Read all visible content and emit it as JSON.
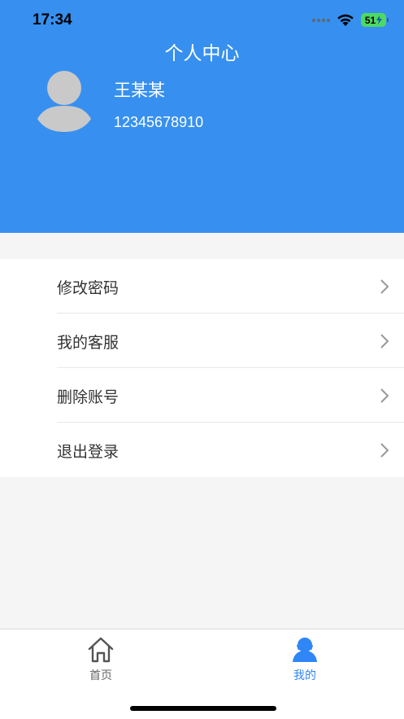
{
  "status_bar": {
    "time": "17:34",
    "battery": "51",
    "icons": [
      "signal-dots-icon",
      "wifi-icon",
      "battery-charging-icon"
    ]
  },
  "header": {
    "title": "个人中心",
    "user_name": "王某某",
    "phone": "12345678910",
    "avatar_icon": "avatar-placeholder-icon",
    "background_color": "#3790ef"
  },
  "menu": {
    "items": [
      {
        "label": "修改密码",
        "icon": "chevron-right-icon"
      },
      {
        "label": "我的客服",
        "icon": "chevron-right-icon"
      },
      {
        "label": "删除账号",
        "icon": "chevron-right-icon"
      },
      {
        "label": "退出登录",
        "icon": "chevron-right-icon"
      }
    ]
  },
  "tabbar": {
    "tabs": [
      {
        "label": "首页",
        "icon": "home-icon",
        "active": false
      },
      {
        "label": "我的",
        "icon": "user-icon",
        "active": true
      }
    ],
    "active_color": "#2f86f6",
    "inactive_color": "#666666"
  }
}
